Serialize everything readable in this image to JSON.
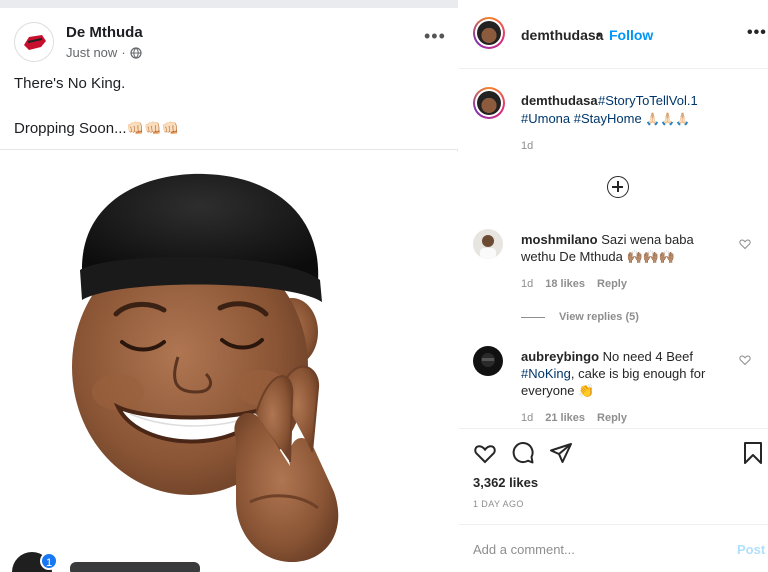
{
  "fb_post": {
    "author": "De Mthuda",
    "time": "Just now",
    "line1": "There's No King.",
    "line2": "Dropping Soon...",
    "line2_emoji": "👊🏻👊🏻👊🏻",
    "notification_count": "1"
  },
  "ig": {
    "header": {
      "username": "demthudasa",
      "dot": "•",
      "follow_label": "Follow",
      "more": "•••"
    },
    "caption": {
      "username": "demthudasa",
      "tag1": "#StoryToTellVol.1",
      "tags_line2": "#Umona #StayHome",
      "emoji": "🙏🏻🙏🏻🙏🏻",
      "age": "1d"
    },
    "comments": [
      {
        "username": "moshmilano",
        "text_a": "Sazi wena baba",
        "text_b": "wethu De Mthuda",
        "emoji": "🙌🏽🙌🏽🙌🏽",
        "age": "1d",
        "likes": "18 likes",
        "reply": "Reply"
      },
      {
        "username": "aubreybingo",
        "text_a": "No need 4 Beef",
        "tag": "#NoKing",
        "text_b": ", cake is big enough for",
        "text_c": "everyone",
        "emoji": "👏",
        "age": "1d",
        "likes": "21 likes",
        "reply": "Reply"
      }
    ],
    "view_replies": "View replies (5)",
    "likes_count": "3,362 likes",
    "post_date": "1 DAY AGO",
    "add_comment_placeholder": "Add a comment...",
    "post_label": "Post"
  },
  "colors": {
    "link_blue": "#0095f6",
    "hashtag_blue": "#00376b",
    "muted": "#8e8e8e",
    "fb_blue": "#1877f2"
  },
  "icons": [
    "globe-icon",
    "more-icon",
    "plus-circle-icon",
    "heart-icon",
    "comment-icon",
    "share-icon",
    "bookmark-icon",
    "small-heart-icon"
  ]
}
